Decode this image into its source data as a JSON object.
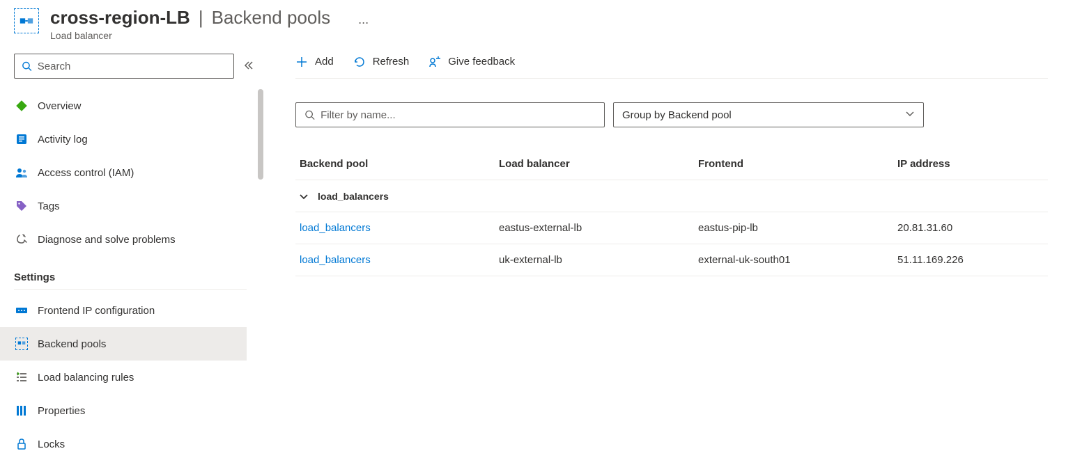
{
  "header": {
    "resource_name": "cross-region-LB",
    "page_name": "Backend pools",
    "subtitle": "Load balancer",
    "more": "..."
  },
  "search": {
    "placeholder": "Search"
  },
  "sidebar": {
    "items": [
      {
        "label": "Overview",
        "icon": "overview"
      },
      {
        "label": "Activity log",
        "icon": "log"
      },
      {
        "label": "Access control (IAM)",
        "icon": "iam"
      },
      {
        "label": "Tags",
        "icon": "tags"
      },
      {
        "label": "Diagnose and solve problems",
        "icon": "diag"
      }
    ],
    "settings_header": "Settings",
    "settings": [
      {
        "label": "Frontend IP configuration",
        "icon": "frontend"
      },
      {
        "label": "Backend pools",
        "icon": "backend",
        "selected": true
      },
      {
        "label": "Load balancing rules",
        "icon": "rules"
      },
      {
        "label": "Properties",
        "icon": "props"
      },
      {
        "label": "Locks",
        "icon": "locks"
      }
    ]
  },
  "toolbar": {
    "add": "Add",
    "refresh": "Refresh",
    "feedback": "Give feedback"
  },
  "filter": {
    "filter_placeholder": "Filter by name...",
    "group_by": "Group by Backend pool"
  },
  "grid": {
    "columns": {
      "pool": "Backend pool",
      "lb": "Load balancer",
      "frontend": "Frontend",
      "ip": "IP address"
    },
    "group_name": "load_balancers",
    "rows": [
      {
        "pool": "load_balancers",
        "lb": "eastus-external-lb",
        "frontend": "eastus-pip-lb",
        "ip": "20.81.31.60"
      },
      {
        "pool": "load_balancers",
        "lb": "uk-external-lb",
        "frontend": "external-uk-south01",
        "ip": "51.11.169.226"
      }
    ]
  }
}
